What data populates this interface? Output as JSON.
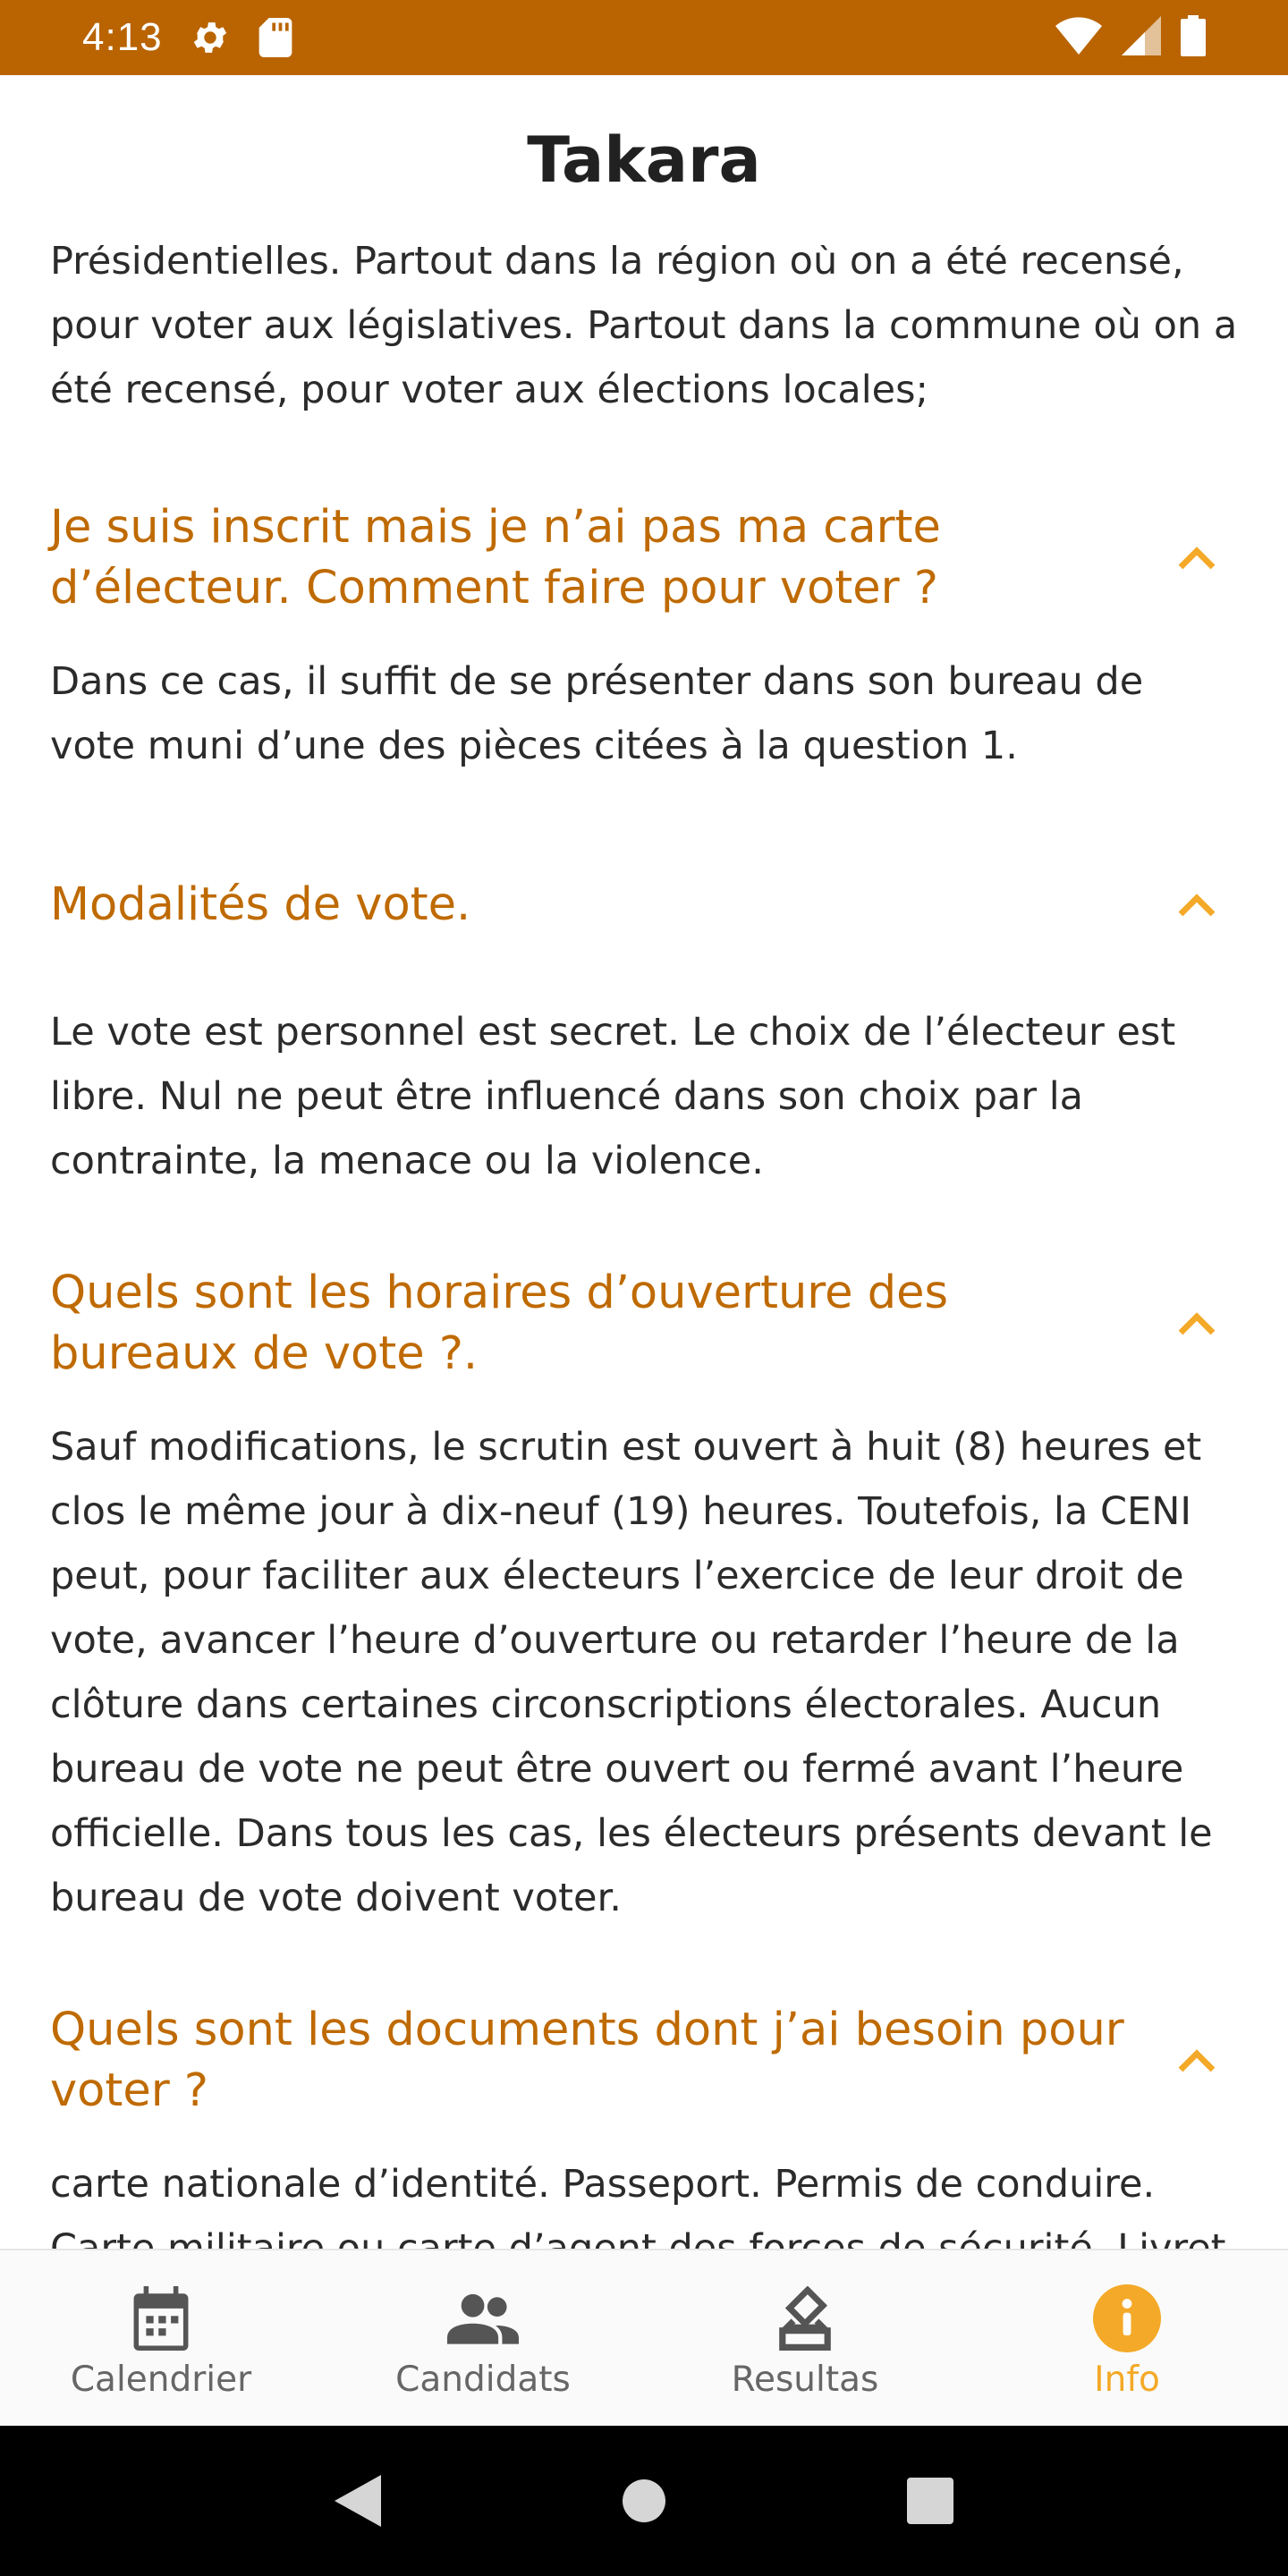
{
  "status_bar": {
    "time": "4:13",
    "color": "#B96400",
    "icons": [
      "gear-icon",
      "sd-card-icon",
      "wifi-icon",
      "signal-icon",
      "battery-icon"
    ]
  },
  "app_bar": {
    "title": "Takara"
  },
  "faq": {
    "partial_answer": {
      "line1": "Présidentielles. Partout dans la région où on a été recensé,",
      "line2": "pour voter aux législatives. Partout dans la commune où on a",
      "line3": "été recensé, pour voter aux élections locales;"
    },
    "items": [
      {
        "question": "Je suis inscrit mais je n’ai pas ma carte d’électeur. Comment faire pour voter ?",
        "answer": "Dans ce cas, il suffit de se présenter dans son bureau de vote muni d’une des pièces citées à la question 1."
      },
      {
        "question": "Modalités de vote.",
        "answer": "Le vote est personnel est secret. Le choix de l’électeur est libre. Nul ne peut être influencé dans son choix par la contrainte, la menace ou la violence."
      },
      {
        "question": "Quels sont les horaires d’ouverture des bureaux de vote ?.",
        "answer": "Sauf modifications, le scrutin est ouvert à huit (8) heures et clos le même jour à dix-neuf (19) heures. Toutefois, la CENI peut, pour faciliter aux électeurs l’exercice de leur droit de vote, avancer l’heure d’ouverture ou retarder l’heure de la clôture dans certaines circonscriptions électorales. Aucun bureau de vote ne peut être ouvert ou fermé avant l’heure officielle. Dans tous les cas, les électeurs présents devant le bureau de vote doivent voter."
      },
      {
        "question": "Quels sont les documents dont j’ai besoin pour voter ?",
        "answer": "carte nationale d’identité. Passeport. Permis de conduire. Carte militaire ou carte d’agent des forces de sécurité. Livret"
      }
    ],
    "accent_color": "#BF6A00"
  },
  "bottom_nav": {
    "items": [
      {
        "label": "Calendrier",
        "icon": "calendar-icon"
      },
      {
        "label": "Candidats",
        "icon": "people-icon"
      },
      {
        "label": "Resultas",
        "icon": "ballot-box-icon"
      },
      {
        "label": "Info",
        "icon": "info-icon"
      }
    ],
    "active": "Info",
    "active_color": "#F4A928"
  },
  "system_nav": {
    "icons": [
      "back-icon",
      "home-icon",
      "recents-icon"
    ]
  }
}
